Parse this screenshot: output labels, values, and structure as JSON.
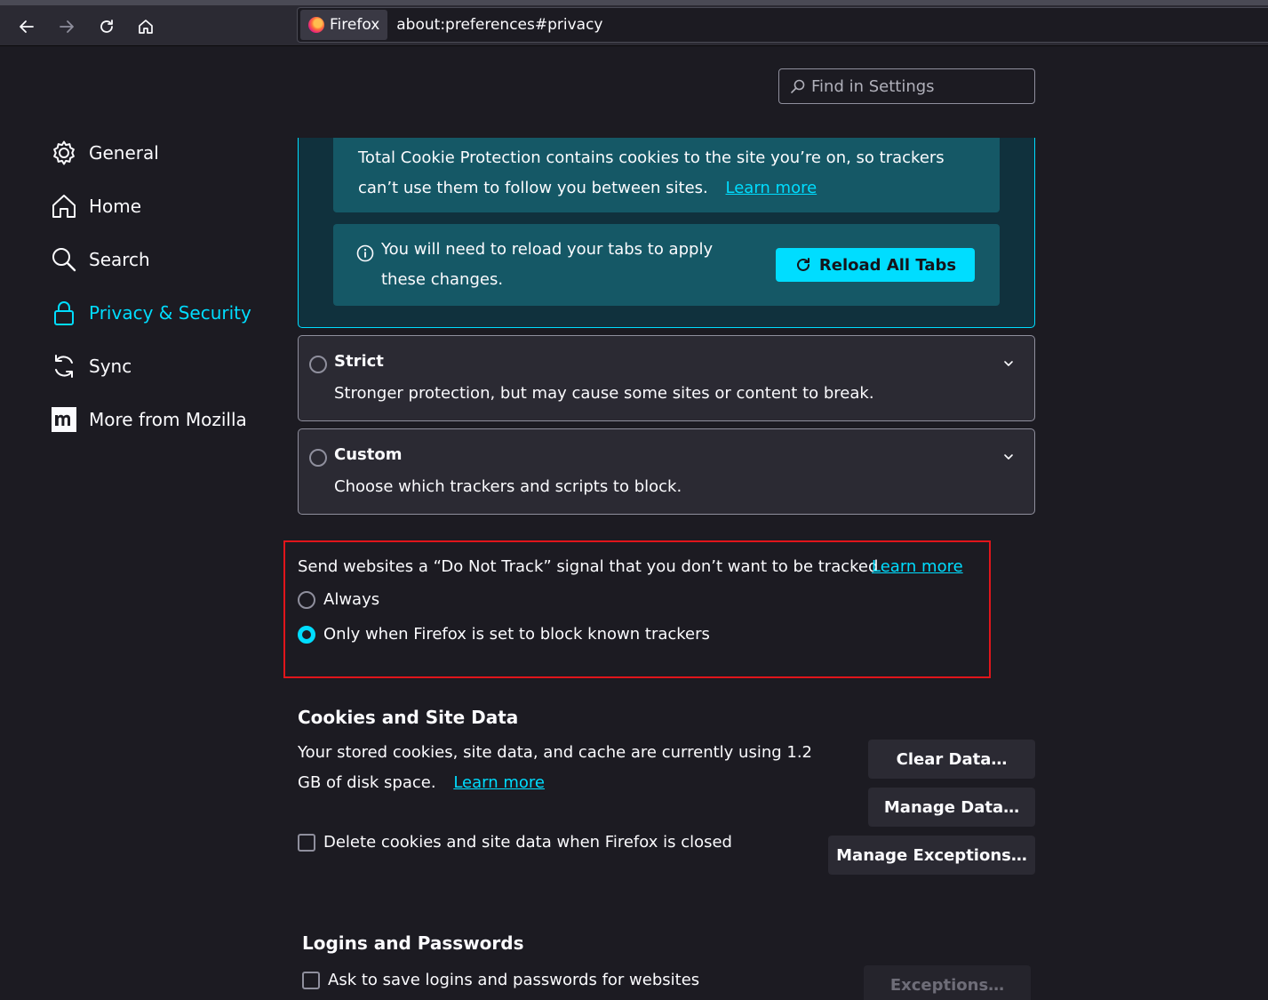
{
  "browser": {
    "identity_label": "Firefox",
    "url": "about:preferences#privacy"
  },
  "search": {
    "placeholder": "Find in Settings"
  },
  "sidebar": {
    "items": [
      {
        "label": "General",
        "icon": "gear-icon"
      },
      {
        "label": "Home",
        "icon": "home-icon"
      },
      {
        "label": "Search",
        "icon": "search-icon"
      },
      {
        "label": "Privacy & Security",
        "icon": "lock-icon",
        "selected": true
      },
      {
        "label": "Sync",
        "icon": "sync-icon"
      },
      {
        "label": "More from Mozilla",
        "icon": "mozilla-icon"
      }
    ]
  },
  "tracking_protection": {
    "tcp_text": "Total Cookie Protection contains cookies to the site you’re on, so trackers can’t use them to follow you between sites.",
    "tcp_learn_more": "Learn more",
    "reload_message": "You will need to reload your tabs to apply these changes.",
    "reload_button": "Reload All Tabs",
    "strict": {
      "title": "Strict",
      "description": "Stronger protection, but may cause some sites or content to break."
    },
    "custom": {
      "title": "Custom",
      "description": "Choose which trackers and scripts to block."
    }
  },
  "do_not_track": {
    "text": "Send websites a “Do Not Track” signal that you don’t want to be tracked",
    "learn_more": "Learn more",
    "options": [
      "Always",
      "Only when Firefox is set to block known trackers"
    ],
    "selected": "Only when Firefox is set to block known trackers"
  },
  "cookies": {
    "heading": "Cookies and Site Data",
    "usage_text": "Your stored cookies, site data, and cache are currently using 1.2 GB of disk space.",
    "learn_more": "Learn more",
    "delete_on_close": "Delete cookies and site data when Firefox is closed",
    "delete_on_close_checked": false,
    "buttons": {
      "clear": "Clear Data…",
      "manage": "Manage Data…",
      "exceptions": "Manage Exceptions…"
    }
  },
  "logins": {
    "heading": "Logins and Passwords",
    "ask_to_save": "Ask to save logins and passwords for websites",
    "ask_to_save_checked": false,
    "exceptions_button": "Exceptions…"
  },
  "colors": {
    "accent": "#00ddff",
    "background": "#1c1b22",
    "highlight_box": "#e0151b"
  }
}
